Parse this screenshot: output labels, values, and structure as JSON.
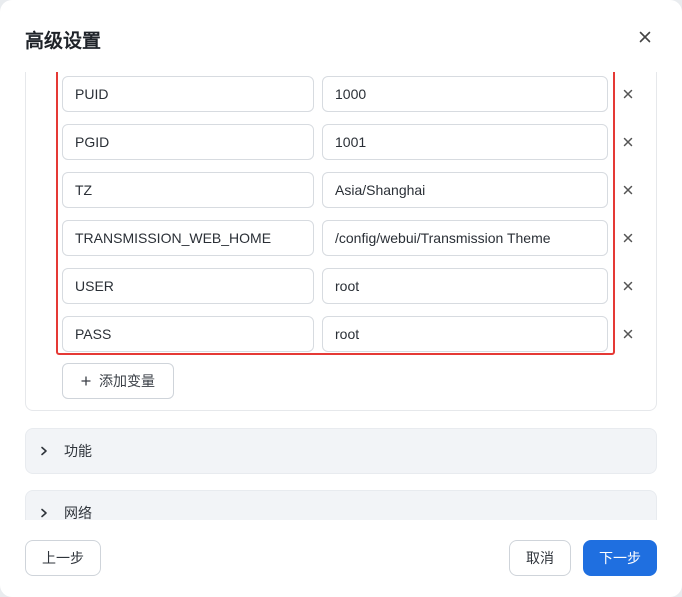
{
  "dialog": {
    "title": "高级设置"
  },
  "env": {
    "rows": [
      {
        "key": "PUID",
        "value": "1000"
      },
      {
        "key": "PGID",
        "value": "1001"
      },
      {
        "key": "TZ",
        "value": "Asia/Shanghai"
      },
      {
        "key": "TRANSMISSION_WEB_HOME",
        "value": "/config/webui/Transmission Theme"
      },
      {
        "key": "USER",
        "value": "root"
      },
      {
        "key": "PASS",
        "value": "root"
      }
    ],
    "add_label": "添加变量"
  },
  "sections": {
    "features": "功能",
    "network": "网络"
  },
  "footer": {
    "prev": "上一步",
    "cancel": "取消",
    "next": "下一步"
  },
  "colors": {
    "highlight": "#e53935",
    "primary": "#1f6fe0"
  }
}
